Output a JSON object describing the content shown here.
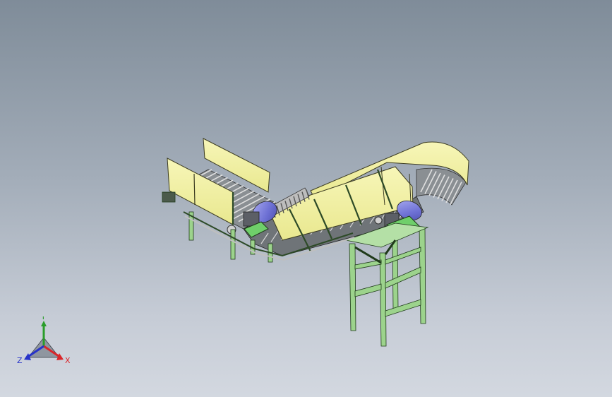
{
  "viewport": {
    "background_top": "#7f8c99",
    "background_bottom": "#d3d8e0"
  },
  "model": {
    "guard_color": "#f4f3a4",
    "guard_edge": "#3b3b20",
    "frame_color": "#9cd38c",
    "frame_edge": "#1f3a1a",
    "motor_color": "#7b7fdc",
    "chain_color": "#c9c9c9",
    "spiral_color": "#bdbdbd"
  },
  "triad": {
    "x_label": "X",
    "y_label": "Y",
    "z_label": "Z",
    "x_color": "#d9262a",
    "y_color": "#2a9d2a",
    "z_color": "#2733c9"
  }
}
